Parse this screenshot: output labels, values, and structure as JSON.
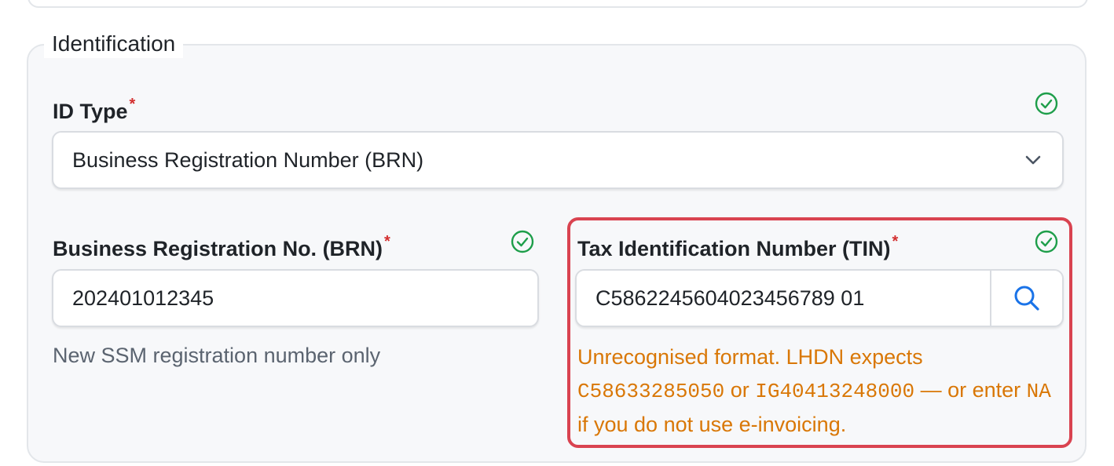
{
  "section": {
    "title": "Identification"
  },
  "id_type": {
    "label": "ID Type",
    "required_mark": "*",
    "selected": "Business Registration Number (BRN)"
  },
  "brn": {
    "label": "Business Registration No. (BRN)",
    "required_mark": "*",
    "value": "202401012345",
    "hint": "New SSM registration number only"
  },
  "tin": {
    "label": "Tax Identification Number (TIN)",
    "required_mark": "*",
    "value": "C5862245604023456789 01",
    "error": {
      "part1": "Unrecognised format. LHDN expects ",
      "example1": "C58633285050",
      "part2": " or ",
      "example2": "IG40413248000",
      "part3": " — or enter ",
      "example3": "NA",
      "part4": " if you do not use e-invoicing."
    }
  },
  "icons": {
    "valid": "check-circle-icon",
    "dropdown": "chevron-down-icon",
    "search": "search-icon"
  },
  "colors": {
    "valid_green": "#1e9e4a",
    "required_red": "#d32f2f",
    "error_orange": "#d97706",
    "error_border": "#d94350",
    "search_blue": "#1a73e8"
  }
}
